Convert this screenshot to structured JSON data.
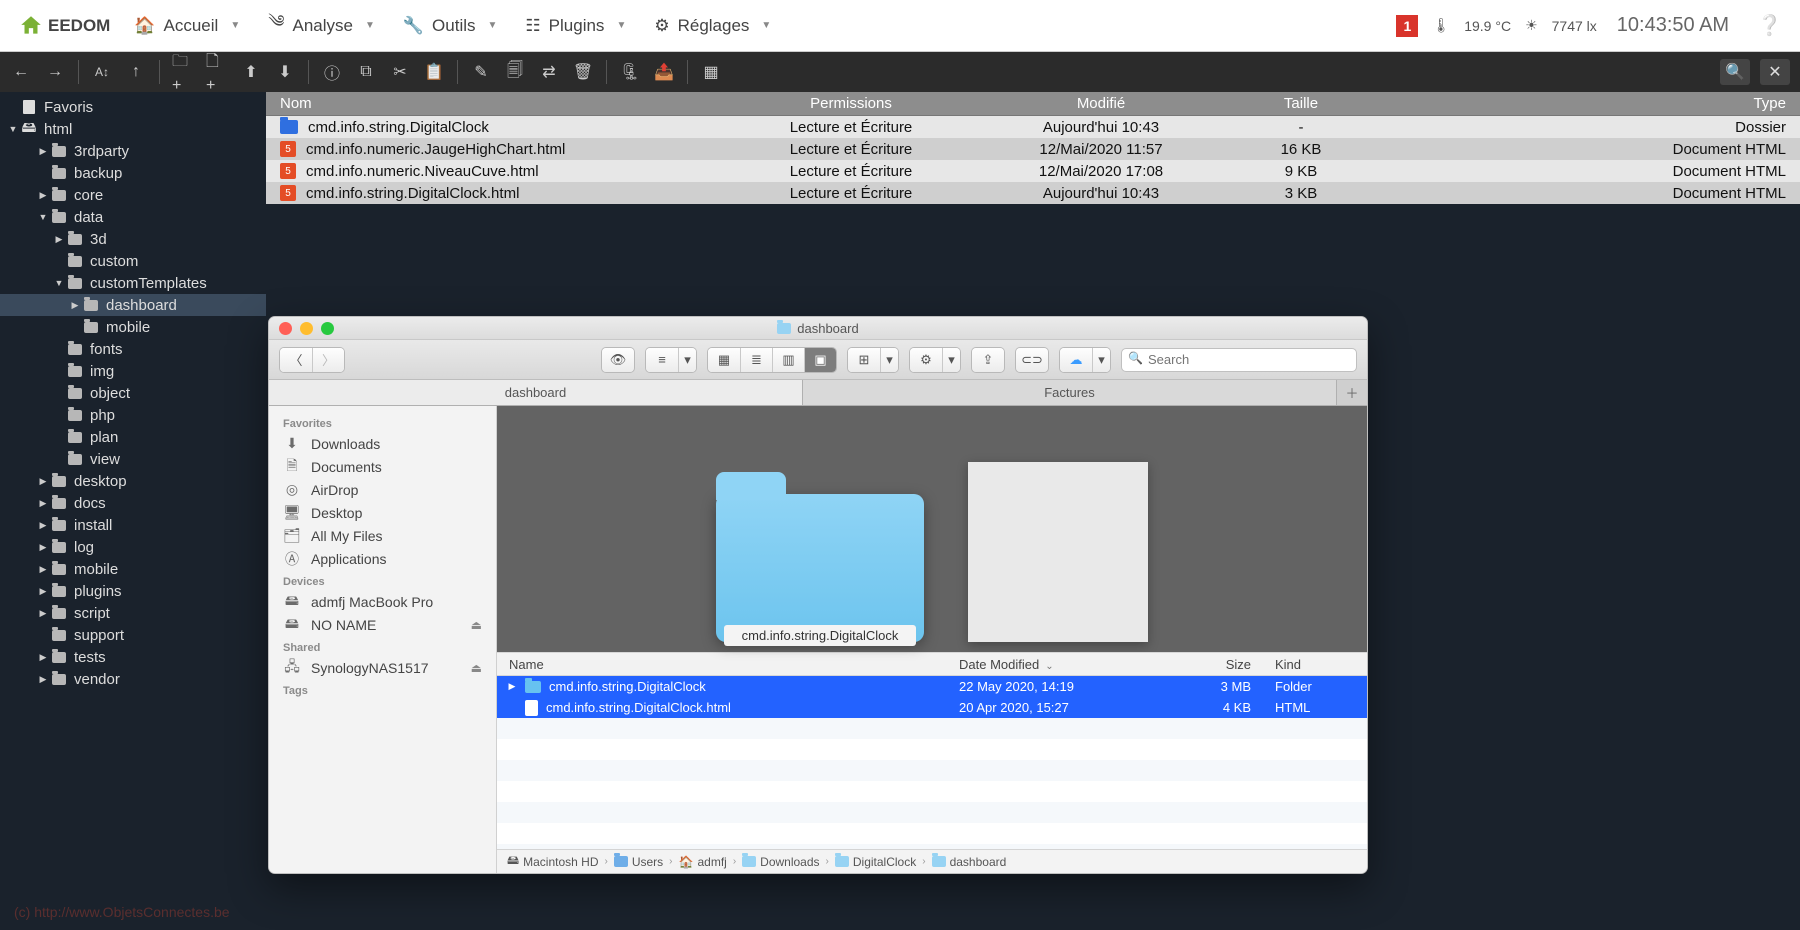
{
  "jeedom": {
    "logo": "EEDOM",
    "menus": {
      "home": "Accueil",
      "analyse": "Analyse",
      "tools": "Outils",
      "plugins": "Plugins",
      "settings": "Réglages"
    },
    "notif": "1",
    "temp": "19.9 °C",
    "lux": "7747 lx",
    "clock": "10:43:50 AM",
    "footer": "(c) http://www.ObjetsConnectes.be"
  },
  "tree": {
    "favorites": "Favoris",
    "root": "html",
    "items": [
      {
        "l": "3rdparty",
        "d": 2,
        "a": "r"
      },
      {
        "l": "backup",
        "d": 2,
        "a": ""
      },
      {
        "l": "core",
        "d": 2,
        "a": "r"
      },
      {
        "l": "data",
        "d": 2,
        "a": "d"
      },
      {
        "l": "3d",
        "d": 3,
        "a": "r"
      },
      {
        "l": "custom",
        "d": 3,
        "a": ""
      },
      {
        "l": "customTemplates",
        "d": 3,
        "a": "d"
      },
      {
        "l": "dashboard",
        "d": 4,
        "a": "r",
        "sel": true
      },
      {
        "l": "mobile",
        "d": 4,
        "a": ""
      },
      {
        "l": "fonts",
        "d": 3,
        "a": ""
      },
      {
        "l": "img",
        "d": 3,
        "a": ""
      },
      {
        "l": "object",
        "d": 3,
        "a": ""
      },
      {
        "l": "php",
        "d": 3,
        "a": ""
      },
      {
        "l": "plan",
        "d": 3,
        "a": ""
      },
      {
        "l": "view",
        "d": 3,
        "a": ""
      },
      {
        "l": "desktop",
        "d": 2,
        "a": "r"
      },
      {
        "l": "docs",
        "d": 2,
        "a": "r"
      },
      {
        "l": "install",
        "d": 2,
        "a": "r"
      },
      {
        "l": "log",
        "d": 2,
        "a": "r"
      },
      {
        "l": "mobile",
        "d": 2,
        "a": "r"
      },
      {
        "l": "plugins",
        "d": 2,
        "a": "r"
      },
      {
        "l": "script",
        "d": 2,
        "a": "r"
      },
      {
        "l": "support",
        "d": 2,
        "a": ""
      },
      {
        "l": "tests",
        "d": 2,
        "a": "r"
      },
      {
        "l": "vendor",
        "d": 2,
        "a": "r"
      }
    ]
  },
  "fm": {
    "headers": {
      "name": "Nom",
      "perm": "Permissions",
      "mod": "Modifié",
      "size": "Taille",
      "type": "Type"
    },
    "rows": [
      {
        "icon": "folder",
        "name": "cmd.info.string.DigitalClock",
        "perm": "Lecture et Écriture",
        "mod": "Aujourd'hui 10:43",
        "size": "-",
        "type": "Dossier"
      },
      {
        "icon": "html",
        "name": "cmd.info.numeric.JaugeHighChart.html",
        "perm": "Lecture et Écriture",
        "mod": "12/Mai/2020 11:57",
        "size": "16 KB",
        "type": "Document HTML"
      },
      {
        "icon": "html",
        "name": "cmd.info.numeric.NiveauCuve.html",
        "perm": "Lecture et Écriture",
        "mod": "12/Mai/2020 17:08",
        "size": "9 KB",
        "type": "Document HTML"
      },
      {
        "icon": "html",
        "name": "cmd.info.string.DigitalClock.html",
        "perm": "Lecture et Écriture",
        "mod": "Aujourd'hui 10:43",
        "size": "3 KB",
        "type": "Document HTML"
      }
    ]
  },
  "finder": {
    "title": "dashboard",
    "tabs": [
      "dashboard",
      "Factures"
    ],
    "search_placeholder": "Search",
    "sidebar": {
      "favorites_h": "Favorites",
      "favorites": [
        "Downloads",
        "Documents",
        "AirDrop",
        "Desktop",
        "All My Files",
        "Applications"
      ],
      "devices_h": "Devices",
      "devices": [
        "admfj MacBook Pro",
        "NO NAME"
      ],
      "shared_h": "Shared",
      "shared": [
        "SynologyNAS1517"
      ],
      "tags_h": "Tags"
    },
    "preview_label": "cmd.info.string.DigitalClock",
    "list": {
      "headers": {
        "name": "Name",
        "date": "Date Modified",
        "size": "Size",
        "kind": "Kind"
      },
      "rows": [
        {
          "icon": "folder",
          "name": "cmd.info.string.DigitalClock",
          "date": "22 May 2020, 14:19",
          "size": "3 MB",
          "kind": "Folder",
          "disc": true
        },
        {
          "icon": "doc",
          "name": "cmd.info.string.DigitalClock.html",
          "date": "20 Apr 2020, 15:27",
          "size": "4 KB",
          "kind": "HTML",
          "disc": false
        }
      ]
    },
    "path": [
      "Macintosh HD",
      "Users",
      "admfj",
      "Downloads",
      "DigitalClock",
      "dashboard"
    ]
  }
}
